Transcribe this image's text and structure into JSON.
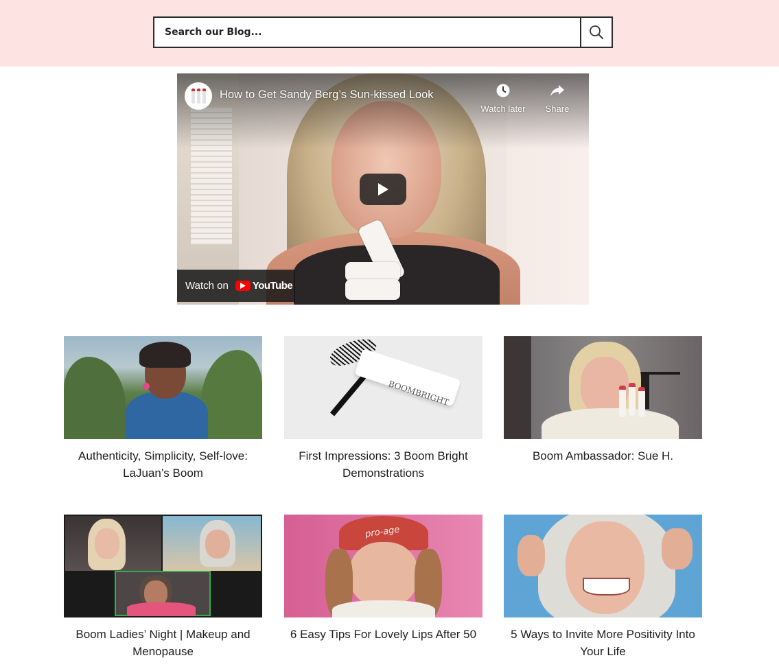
{
  "search": {
    "placeholder": "Search our Blog...",
    "icon": "search-icon"
  },
  "video": {
    "title": "How to Get Sandy Berg’s Sun-kissed Look",
    "watch_later_label": "Watch later",
    "share_label": "Share",
    "watch_on_label": "Watch on",
    "youtube_label": "YouTube"
  },
  "posts": [
    {
      "caption": "Authenticity, Simplicity, Self-love: LaJuan’s Boom"
    },
    {
      "caption": "First Impressions: 3 Boom Bright Demonstrations",
      "thumb_text": "BOOMBRIGHT"
    },
    {
      "caption": "Boom Ambassador: Sue H."
    },
    {
      "caption": "Boom Ladies’ Night | Makeup and Menopause"
    },
    {
      "caption": "6 Easy Tips For Lovely Lips After 50",
      "thumb_text": "pro-age"
    },
    {
      "caption": "5 Ways to Invite More Positivity Into Your Life"
    }
  ],
  "colors": {
    "header_bg": "#fde3e1",
    "text": "#1d1d1d",
    "youtube_red": "#ff0000"
  }
}
